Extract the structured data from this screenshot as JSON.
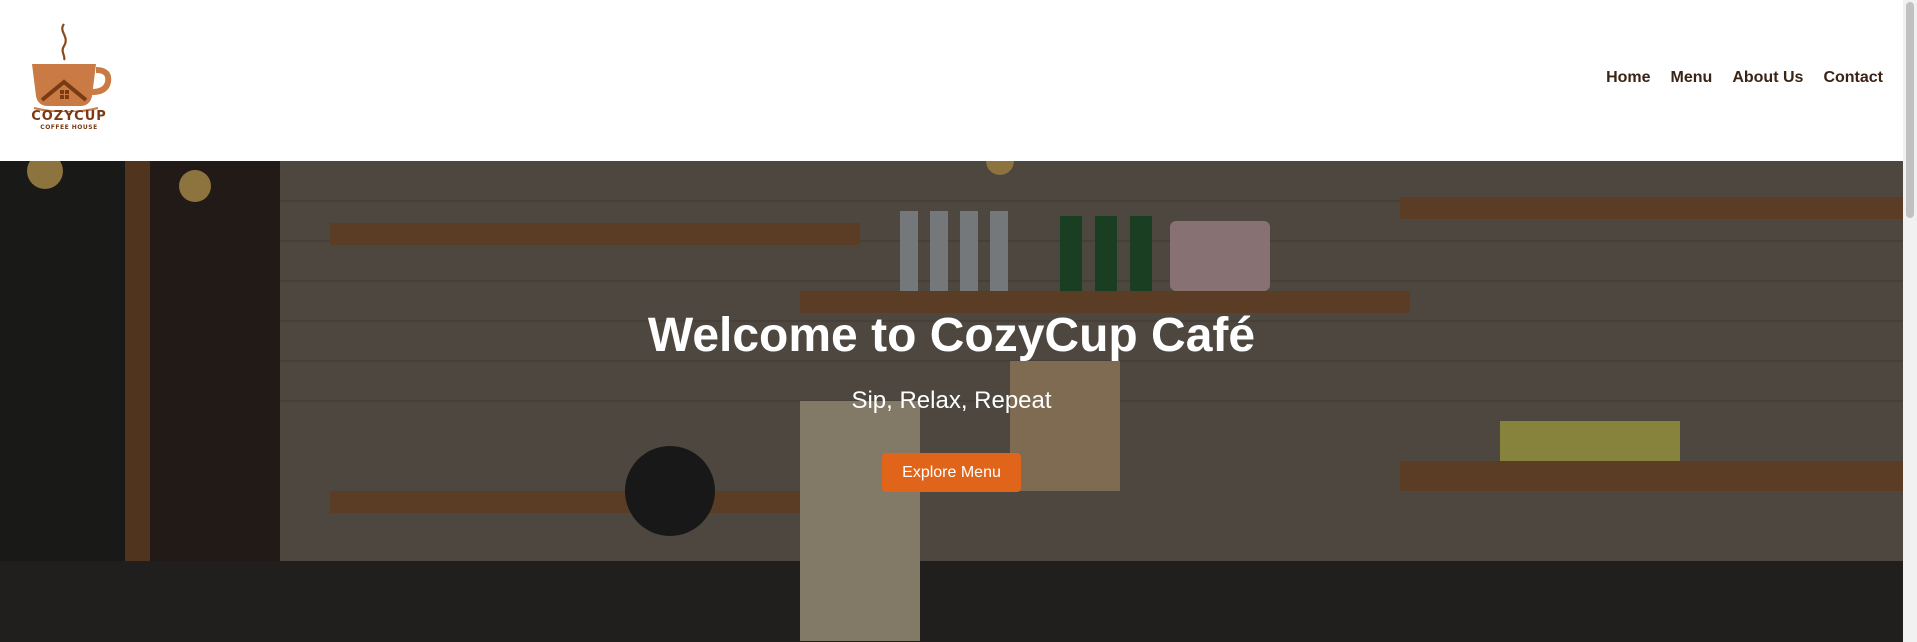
{
  "brand": {
    "name": "COZYCUP",
    "tagline": "COFFEE HOUSE",
    "logo_icon": "coffee-cup-house-icon",
    "color": "#7a3a12"
  },
  "nav": {
    "items": [
      {
        "label": "Home"
      },
      {
        "label": "Menu"
      },
      {
        "label": "About Us"
      },
      {
        "label": "Contact"
      }
    ]
  },
  "hero": {
    "title": "Welcome to CozyCup Café",
    "subtitle": "Sip, Relax, Repeat",
    "cta_label": "Explore Menu",
    "cta_color": "#e0651a"
  }
}
